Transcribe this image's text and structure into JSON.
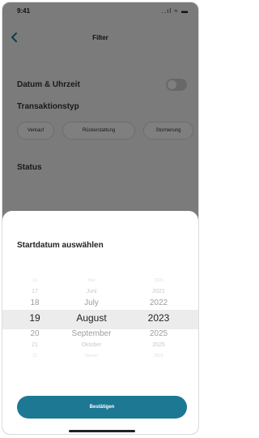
{
  "status_bar": {
    "time": "9:41",
    "icons": "..ıl ≈ ▬"
  },
  "nav": {
    "title": "Filter",
    "back_icon": "chevron-left-icon"
  },
  "filters": {
    "date_time_label": "Datum & Uhrzeit",
    "date_time_toggle_on": false,
    "transaction_type_label": "Transaktionstyp",
    "transaction_types": [
      "Verkauf",
      "Rückerstattung",
      "Stornierung"
    ],
    "status_label": "Status"
  },
  "sheet": {
    "title": "Startdatum auswählen",
    "days": [
      "16",
      "17",
      "18",
      "19",
      "20",
      "21",
      "22"
    ],
    "months": [
      "Mai",
      "Juni",
      "July",
      "August",
      "September",
      "Oktober",
      "Novem"
    ],
    "years": [
      "2020",
      "2021",
      "2022",
      "2023",
      "2025",
      "2025",
      "2026"
    ],
    "selected": {
      "day": "19",
      "month": "August",
      "year": "2023"
    },
    "confirm_label": "Bestätigen"
  },
  "colors": {
    "accent": "#1d7894",
    "overlay": "rgba(0,0,0,0.5)"
  }
}
